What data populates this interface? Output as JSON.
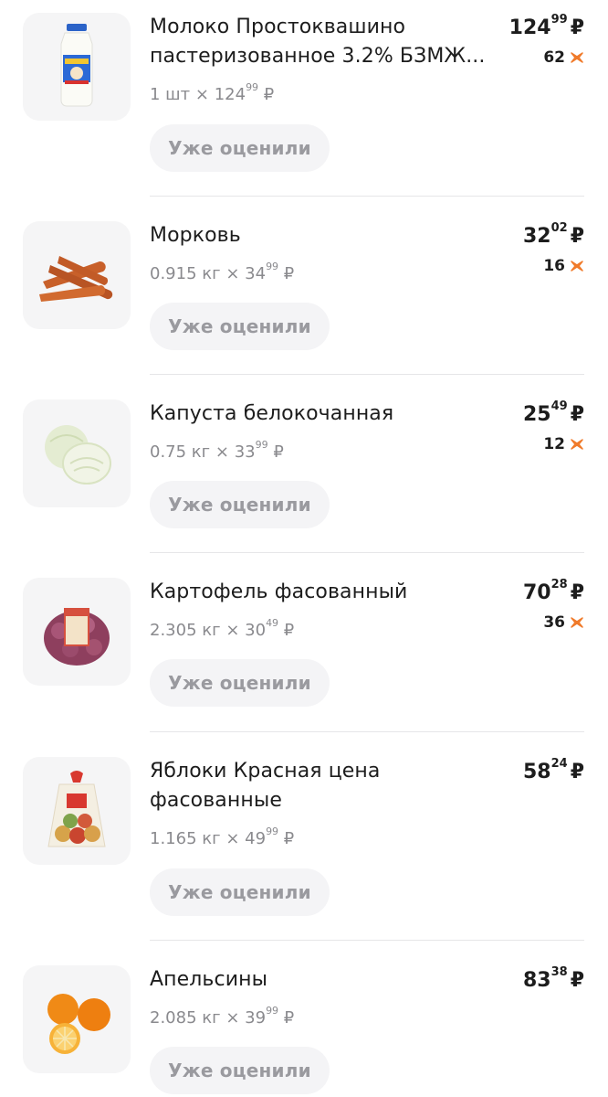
{
  "rate_label": "Уже оценили",
  "items": [
    {
      "name": "Молоко Простоквашино пастеризованное 3.2% БЗМЖ...",
      "qty": "1 шт",
      "unit_int": "124",
      "unit_dec": "99",
      "price_int": "124",
      "price_dec": "99",
      "bonus": "62",
      "image": "milk-bottle-image"
    },
    {
      "name": "Морковь",
      "qty": "0.915 кг",
      "unit_int": "34",
      "unit_dec": "99",
      "price_int": "32",
      "price_dec": "02",
      "bonus": "16",
      "image": "carrots-image"
    },
    {
      "name": "Капуста белокочанная",
      "qty": "0.75 кг",
      "unit_int": "33",
      "unit_dec": "99",
      "price_int": "25",
      "price_dec": "49",
      "bonus": "12",
      "image": "cabbage-image"
    },
    {
      "name": "Картофель фасованный",
      "qty": "2.305 кг",
      "unit_int": "30",
      "unit_dec": "49",
      "price_int": "70",
      "price_dec": "28",
      "bonus": "36",
      "image": "potato-bag-image"
    },
    {
      "name": "Яблоки Красная цена фасованные",
      "qty": "1.165 кг",
      "unit_int": "49",
      "unit_dec": "99",
      "price_int": "58",
      "price_dec": "24",
      "bonus": "",
      "image": "apple-bag-image"
    },
    {
      "name": "Апельсины",
      "qty": "2.085 кг",
      "unit_int": "39",
      "unit_dec": "99",
      "price_int": "83",
      "price_dec": "38",
      "bonus": "",
      "image": "oranges-image"
    }
  ],
  "currency": "₽",
  "times": "×",
  "colors": {
    "bonus_star": "#f07a2a",
    "button_bg": "#f4f4f6",
    "button_text": "#9a9a9f"
  }
}
